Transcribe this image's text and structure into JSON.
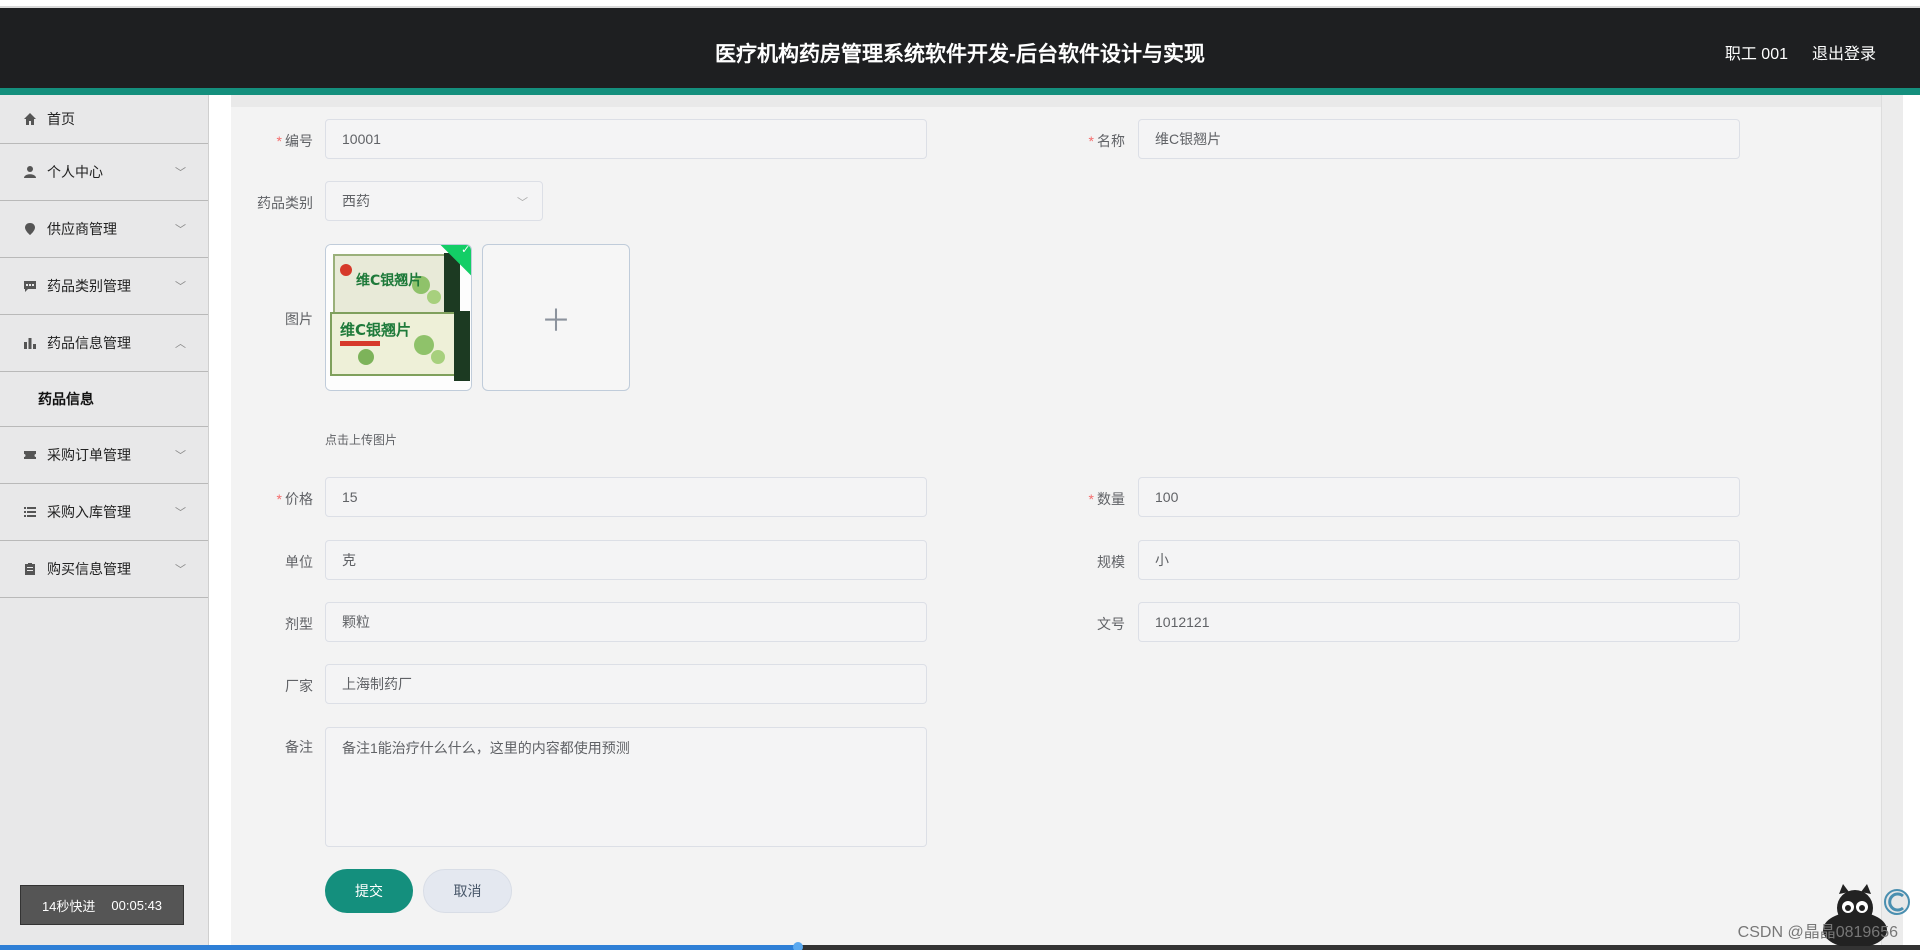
{
  "header": {
    "title": "医疗机构药房管理系统软件开发-后台软件设计与实现",
    "user": "职工 001",
    "logout": "退出登录"
  },
  "sidebar": {
    "items": [
      {
        "label": "首页",
        "icon": "home-icon"
      },
      {
        "label": "个人中心",
        "icon": "user-icon"
      },
      {
        "label": "供应商管理",
        "icon": "location-icon"
      },
      {
        "label": "药品类别管理",
        "icon": "chat-icon"
      },
      {
        "label": "药品信息管理",
        "icon": "bar-chart-icon"
      },
      {
        "label": "采购订单管理",
        "icon": "ticket-icon"
      },
      {
        "label": "采购入库管理",
        "icon": "list-icon"
      },
      {
        "label": "购买信息管理",
        "icon": "clipboard-icon"
      }
    ],
    "subitem": "药品信息"
  },
  "video_overlay": {
    "speed": "14秒快进",
    "time": "00:05:43"
  },
  "form": {
    "code": {
      "label": "编号",
      "value": "10001"
    },
    "name": {
      "label": "名称",
      "value": "维C银翘片"
    },
    "category": {
      "label": "药品类别",
      "value": "西药"
    },
    "image": {
      "label": "图片",
      "tip": "点击上传图片"
    },
    "price": {
      "label": "价格",
      "value": "15"
    },
    "quantity": {
      "label": "数量",
      "value": "100"
    },
    "unit": {
      "label": "单位",
      "value": "克"
    },
    "spec": {
      "label": "规模",
      "value": "小"
    },
    "dosage_form": {
      "label": "剂型",
      "value": "颗粒"
    },
    "approval_no": {
      "label": "文号",
      "value": "1012121"
    },
    "manufacturer": {
      "label": "厂家",
      "value": "上海制药厂"
    },
    "remark": {
      "label": "备注",
      "value": "备注1能治疗什么什么，这里的内容都使用预测"
    },
    "submit": "提交",
    "cancel": "取消"
  },
  "package_image": {
    "brand": "维C银翘片"
  },
  "watermark": "CSDN @晶晶0819656",
  "colors": {
    "accent": "#148f7d",
    "header_bg": "#1e1f21",
    "required": "#f56c6c",
    "success": "#13ce66"
  }
}
